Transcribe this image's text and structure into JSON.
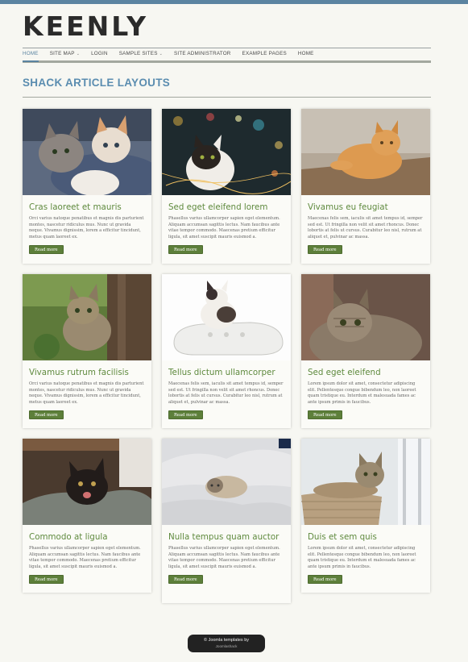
{
  "site": {
    "logo": "KEENLY"
  },
  "nav": {
    "items": [
      {
        "label": "HOME"
      },
      {
        "label": "SITE MAP"
      },
      {
        "label": "LOGIN"
      },
      {
        "label": "SAMPLE SITES"
      },
      {
        "label": "SITE ADMINISTRATOR"
      },
      {
        "label": "EXAMPLE PAGES"
      },
      {
        "label": "HOME"
      }
    ],
    "caret": "⌄"
  },
  "page": {
    "title": "SHACK ARTICLE LAYOUTS"
  },
  "cards": [
    {
      "title": "Cras laoreet et mauris",
      "text": "Orci varius natoque penatibus et magnis dis parturient montes, nascetur ridiculus mus. Nunc ut gravida neque. Vivamus dignissim, lorem a efficitur tincidunt, metus quam laoreet ex.",
      "button": "Read more",
      "image": "kittens-trio"
    },
    {
      "title": "Sed eget eleifend lorem",
      "text": "Phasellus varius ullamcorper sapien eget elementum. Aliquam accumsan sagittis lectus. Nam faucibus ante vitae tempor commodo. Maecenas pretium efficitur ligula, sit amet suscipit mauris euismod a.",
      "button": "Read more",
      "image": "kitten-lights"
    },
    {
      "title": "Vivamus eu feugiat",
      "text": "Maecenas felis sem, iaculis sit amet tempus id, semper sed est. Ut fringilla non velit sit amet rhoncus. Donec lobortis at felis ut cursus. Curabitur leo nisl, rutrum at aliquet et, pulvinar ac massa.",
      "button": "Read more",
      "image": "orange-cat"
    },
    {
      "title": "Vivamus rutrum facilisis",
      "text": "Orci varius natoque penatibus et magnis dis parturient montes, nascetur ridiculus mus. Nunc ut gravida neque. Vivamus dignissim, lorem a efficitur tincidunt, metus quam laoreet ex.",
      "button": "Read more",
      "image": "tabby-tree"
    },
    {
      "title": "Tellus dictum ullamcorper",
      "text": "Maecenas felis sem, iaculis sit amet tempus id, semper sed est. Ut fringilla non velit sit amet rhoncus. Donec lobortis at felis ut cursus. Curabitur leo nisl, rutrum at aliquet et, pulvinar ac massa.",
      "button": "Read more",
      "image": "kitten-shoe"
    },
    {
      "title": "Sed eget eleifend",
      "text": "Lorem ipsum dolor sit amet, consectetur adipiscing elit. Pellentesque congue bibendum leo, non laoreet quam tristique eu. Interdum et malesuada fames ac ante ipsum primis in faucibus.",
      "button": "Read more",
      "image": "tabby-closeup"
    },
    {
      "title": "Commodo at ligula",
      "text": "Phasellus varius ullamcorper sapien eget elementum. Aliquam accumsan sagittis lectus. Nam faucibus ante vitae tempor commodo. Maecenas pretium efficitur ligula, sit amet suscipit mauris euismod a.",
      "button": "Read more",
      "image": "black-kitten"
    },
    {
      "title": "Nulla tempus quam auctor",
      "text": "Phasellus varius ullamcorper sapien eget elementum. Aliquam accumsan sagittis lectus. Nam faucibus ante vitae tempor commodo. Maecenas pretium efficitur ligula, sit amet suscipit mauris euismod a.",
      "button": "Read more",
      "image": "cat-blanket"
    },
    {
      "title": "Duis et sem quis",
      "text": "Lorem ipsum dolor sit amet, consectetur adipiscing elit. Pellentesque congue bibendum leo, non laoreet quam tristique eu. Interdum et malesuada fames ac ante ipsum primis in faucibus.",
      "button": "Read more",
      "image": "cat-basket"
    }
  ],
  "footer": {
    "line1": "© Joomla templates by",
    "line2": "Joomlashack"
  },
  "colors": {
    "accent": "#5b84a1",
    "title_green": "#5f8a3e",
    "button_green": "#5d7f3a"
  }
}
